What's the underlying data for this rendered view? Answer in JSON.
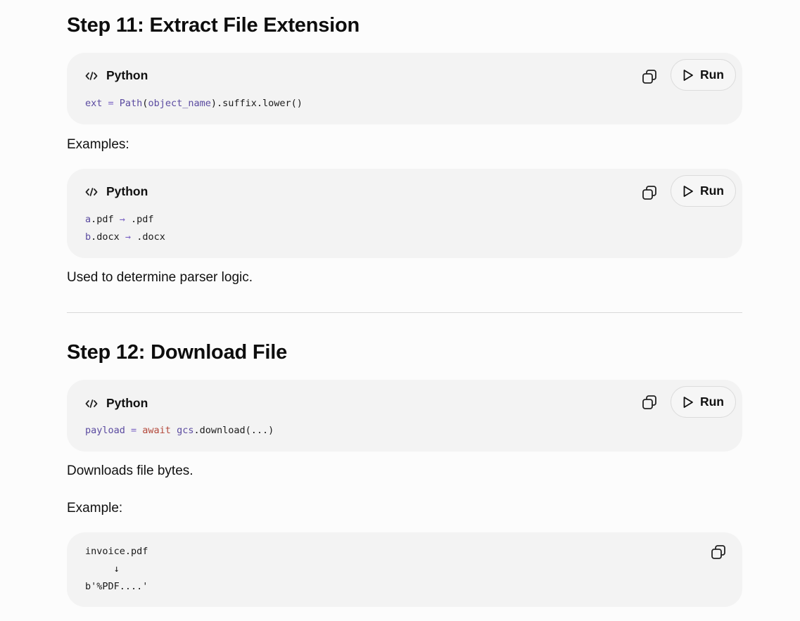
{
  "step11": {
    "title": "Step 11: Extract File Extension",
    "block1": {
      "lang": "Python",
      "run": "Run",
      "code": {
        "t1": "ext",
        "t2": " = ",
        "t3": "Path",
        "t4": "(",
        "t5": "object_name",
        "t6": ").suffix.lower()"
      }
    },
    "examples_label": "Examples:",
    "block2": {
      "lang": "Python",
      "run": "Run",
      "line1": {
        "a": "a",
        "b": ".pdf ",
        "arrow": "→",
        "c": " .pdf"
      },
      "line2": {
        "a": "b",
        "b": ".docx ",
        "arrow": "→",
        "c": " .docx"
      }
    },
    "note": "Used to determine parser logic."
  },
  "step12": {
    "title": "Step 12: Download File",
    "block1": {
      "lang": "Python",
      "run": "Run",
      "code": {
        "t1": "payload",
        "t2": " = ",
        "t3": "await",
        "t4": " ",
        "t5": "gcs",
        "t6": ".download(...)"
      }
    },
    "note": "Downloads file bytes.",
    "example_label": "Example:",
    "block2": {
      "line1": "invoice.pdf",
      "line2": "     ↓",
      "line3": "b'%PDF....'"
    }
  },
  "icons": {
    "code": "code-icon",
    "copy": "copy-icon",
    "play": "play-icon"
  }
}
